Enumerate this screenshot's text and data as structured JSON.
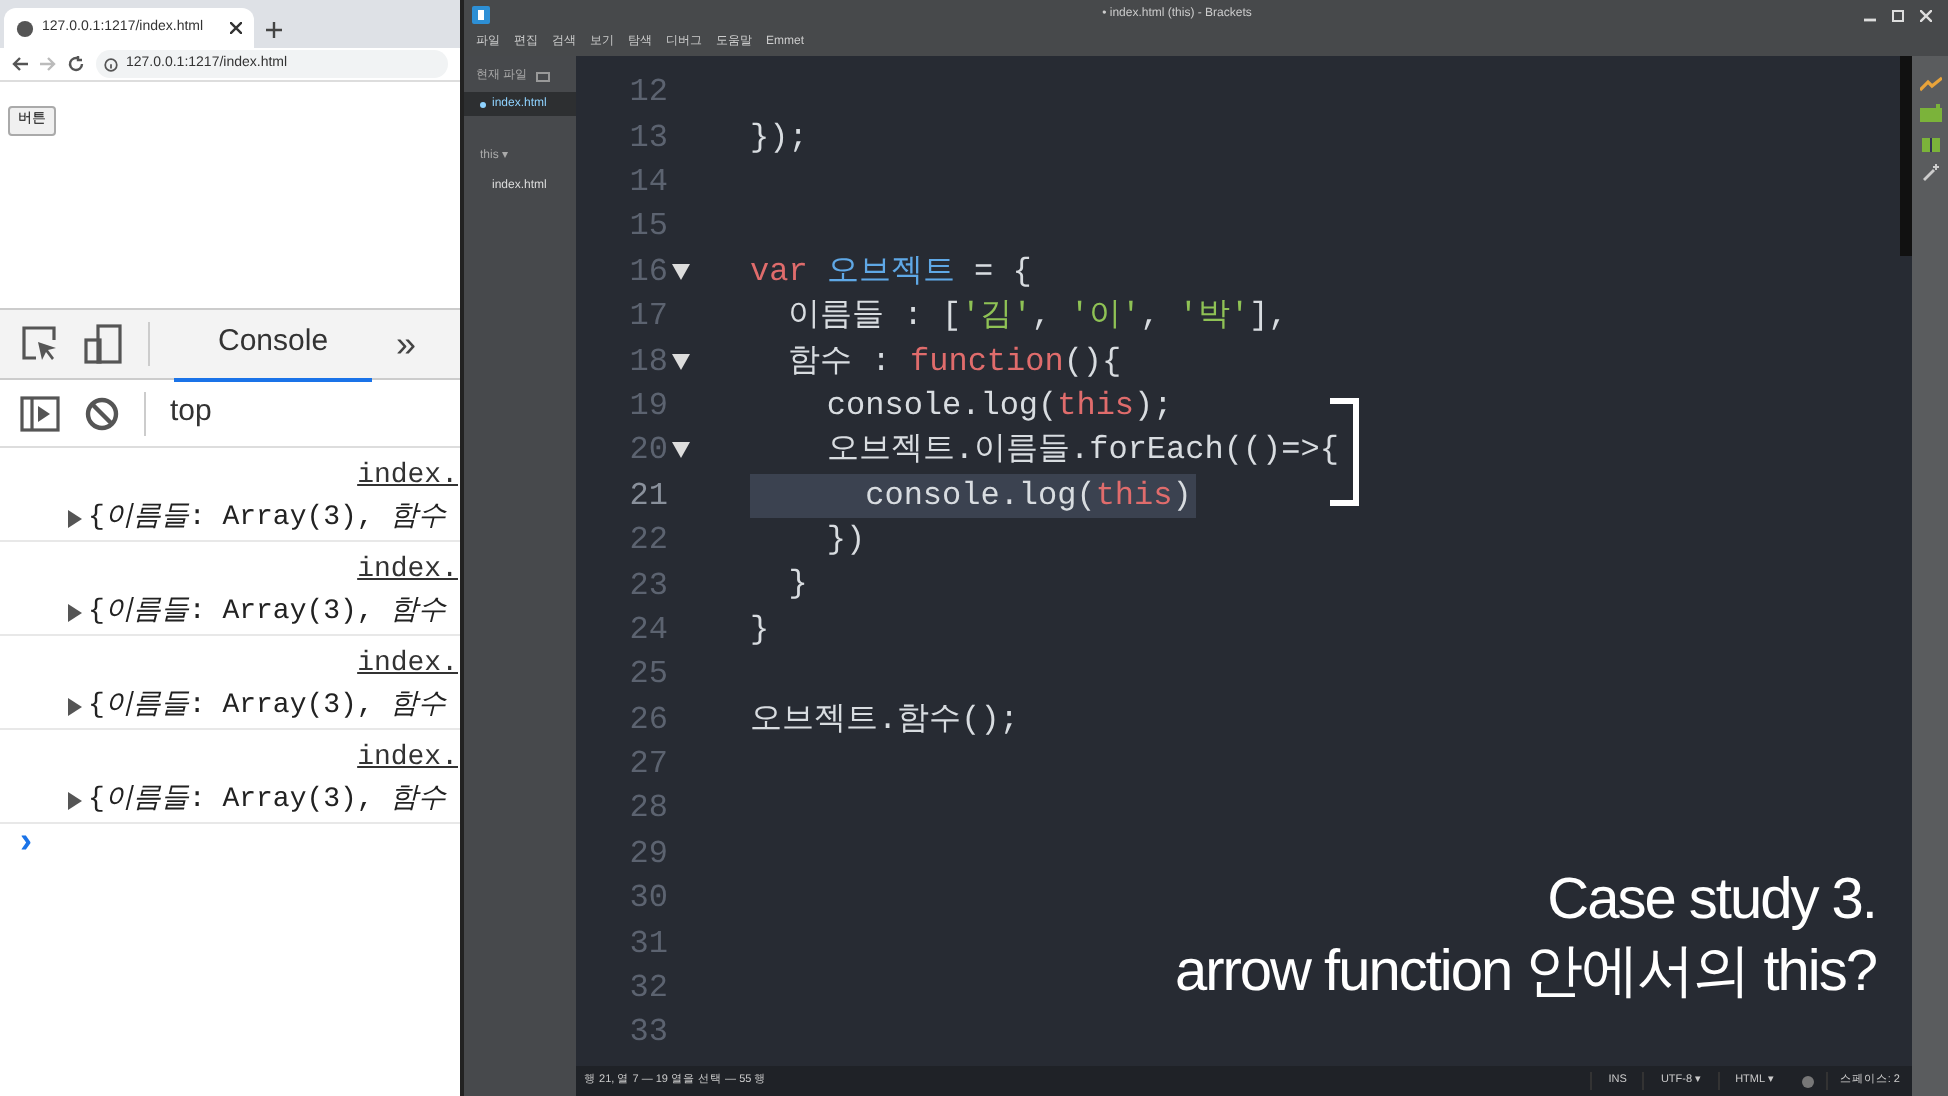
{
  "browser": {
    "tab_title": "127.0.0.1:1217/index.html",
    "address": "127.0.0.1:1217/index.html",
    "page_button": "버튼"
  },
  "devtools": {
    "tabs": [
      {
        "label": "Console",
        "selected": true
      }
    ],
    "more": "»",
    "context": "top",
    "messages": [
      {
        "source": "index.",
        "text": "{*이름들*: Array(3), *함수*"
      },
      {
        "source": "index.",
        "text": "{*이름들*: Array(3), *함수*"
      },
      {
        "source": "index.",
        "text": "{*이름들*: Array(3), *함수*"
      },
      {
        "source": "index.",
        "text": "{*이름들*: Array(3), *함수*"
      }
    ],
    "prompt": "›"
  },
  "editor": {
    "title": "• index.html (this) - Brackets",
    "menu": [
      "파일",
      "편집",
      "검색",
      "보기",
      "탐색",
      "디버그",
      "도움말",
      "Emmet"
    ],
    "sidebar": {
      "working_label": "현재 파일",
      "working_files": [
        {
          "name": "index.html",
          "selected": true,
          "modified": true
        }
      ],
      "project": "this ▾",
      "project_files": [
        {
          "name": "index.html",
          "selected": false
        }
      ]
    },
    "lines": [
      {
        "number": "12",
        "fold": false,
        "selected": false
      },
      {
        "number": "13",
        "fold": false,
        "selected": false,
        "tokens": [
          {
            "text": "});",
            "kind": "plain"
          }
        ]
      },
      {
        "number": "14",
        "fold": false,
        "selected": false
      },
      {
        "number": "15",
        "fold": false,
        "selected": false
      },
      {
        "number": "16",
        "fold": true,
        "selected": false,
        "tokens": [
          {
            "text": "var ",
            "kind": "keyword"
          },
          {
            "text": "오브젝트",
            "kind": "variable"
          },
          {
            "text": " = {",
            "kind": "plain"
          }
        ]
      },
      {
        "number": "17",
        "fold": false,
        "selected": false,
        "tokens": [
          {
            "text": "  이름들 : [",
            "kind": "plain"
          },
          {
            "text": "'김'",
            "kind": "string"
          },
          {
            "text": ", ",
            "kind": "plain"
          },
          {
            "text": "'이'",
            "kind": "string"
          },
          {
            "text": ", ",
            "kind": "plain"
          },
          {
            "text": "'박'",
            "kind": "string"
          },
          {
            "text": "],",
            "kind": "plain"
          }
        ]
      },
      {
        "number": "18",
        "fold": true,
        "selected": false,
        "tokens": [
          {
            "text": "  함수 : ",
            "kind": "plain"
          },
          {
            "text": "function",
            "kind": "keyword"
          },
          {
            "text": "(){",
            "kind": "plain"
          }
        ]
      },
      {
        "number": "19",
        "fold": false,
        "selected": false,
        "tokens": [
          {
            "text": "    console.log(",
            "kind": "plain"
          },
          {
            "text": "this",
            "kind": "keyword"
          },
          {
            "text": ");",
            "kind": "plain"
          }
        ]
      },
      {
        "number": "20",
        "fold": true,
        "selected": false,
        "tokens": [
          {
            "text": "    오브젝트.이름들.forEach(()=>{",
            "kind": "plain"
          }
        ]
      },
      {
        "number": "21",
        "fold": false,
        "selected": true,
        "tokens": [
          {
            "text": "      console.log(",
            "kind": "plain"
          },
          {
            "text": "this",
            "kind": "keyword"
          },
          {
            "text": ")",
            "kind": "plain"
          }
        ]
      },
      {
        "number": "22",
        "fold": false,
        "selected": false,
        "tokens": [
          {
            "text": "    })",
            "kind": "plain"
          }
        ]
      },
      {
        "number": "23",
        "fold": false,
        "selected": false,
        "tokens": [
          {
            "text": "  }",
            "kind": "plain"
          }
        ]
      },
      {
        "number": "24",
        "fold": false,
        "selected": false,
        "tokens": [
          {
            "text": "}",
            "kind": "plain"
          }
        ]
      },
      {
        "number": "25",
        "fold": false,
        "selected": false
      },
      {
        "number": "26",
        "fold": false,
        "selected": false,
        "tokens": [
          {
            "text": "오브젝트.함수();",
            "kind": "plain"
          }
        ]
      },
      {
        "number": "27",
        "fold": false,
        "selected": false
      },
      {
        "number": "28",
        "fold": false,
        "selected": false
      },
      {
        "number": "29",
        "fold": false,
        "selected": false
      },
      {
        "number": "30",
        "fold": false,
        "selected": false
      },
      {
        "number": "31",
        "fold": false,
        "selected": false
      },
      {
        "number": "32",
        "fold": false,
        "selected": false
      },
      {
        "number": "33",
        "fold": false,
        "selected": false
      }
    ],
    "status": {
      "cursor": "행 21, 열 7 — 19 열을 선택 — 55 행",
      "mode": "INS",
      "encoding": "UTF-8 ▾",
      "language": "HTML ▾",
      "indent": "스페이스: 2"
    }
  },
  "caption": [
    "Case study 3.",
    "arrow function 안에서의 this?"
  ]
}
